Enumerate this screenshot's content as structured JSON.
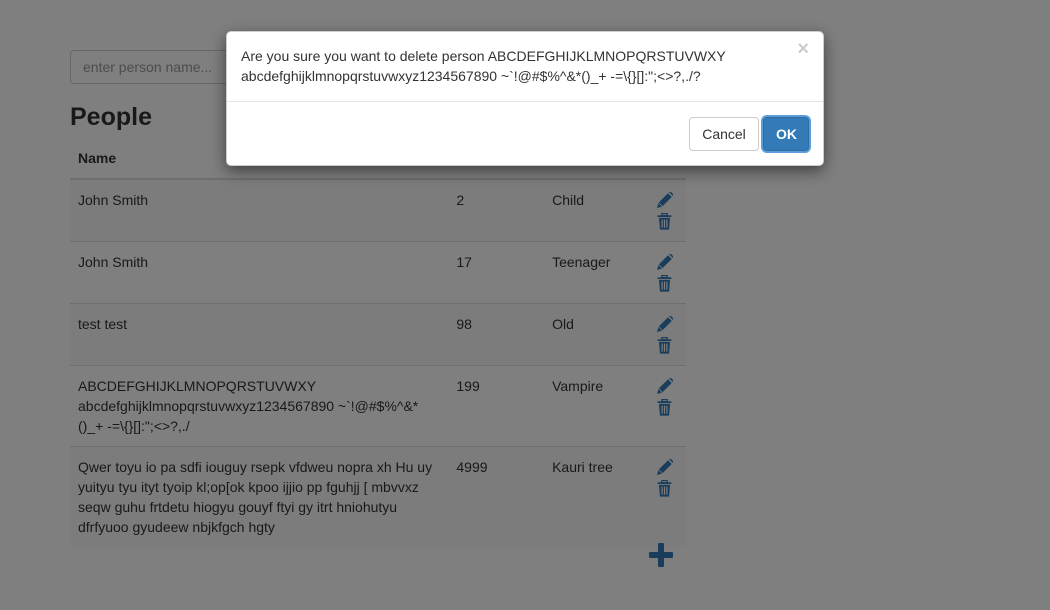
{
  "search": {
    "placeholder": "enter person name..."
  },
  "page": {
    "title": "People"
  },
  "table": {
    "headers": {
      "name": "Name",
      "age": "",
      "category": "",
      "actions": ""
    },
    "rows": [
      {
        "name": "John Smith",
        "age": "2",
        "category": "Child"
      },
      {
        "name": "John Smith",
        "age": "17",
        "category": "Teenager"
      },
      {
        "name": "test test",
        "age": "98",
        "category": "Old"
      },
      {
        "name": "ABCDEFGHIJKLMNOPQRSTUVWXY abcdefghijklmnopqrstuvwxyz1234567890 ~`!@#$%^&*()_+ -=\\{}[]:\";<>?,./",
        "age": "199",
        "category": "Vampire"
      },
      {
        "name": "Qwer toyu io pa sdfi iouguy rsepk vfdweu nopra xh Hu uy yuityu tyu ityt tyoip kl;op[ok kpoo ijjio pp fguhjj [ mbvvxz seqw guhu frtdetu hiogyu gouyf ftyi gy itrt hniohutyu dfrfyuoo gyudeew nbjkfgch hgty",
        "age": "4999",
        "category": "Kauri tree"
      }
    ]
  },
  "icons": {
    "edit": "pencil-icon",
    "delete": "trash-icon",
    "add": "plus-icon",
    "close": "close-icon"
  },
  "colors": {
    "accent": "#337ab7",
    "icon": "#337ab7"
  },
  "modal": {
    "message": "Are you sure you want to delete person ABCDEFGHIJKLMNOPQRSTUVWXY abcdefghijklmnopqrstuvwxyz1234567890 ~`!@#$%^&*()_+ -=\\{}[]:\";<>?,./?",
    "close_label": "×",
    "cancel_label": "Cancel",
    "ok_label": "OK"
  }
}
